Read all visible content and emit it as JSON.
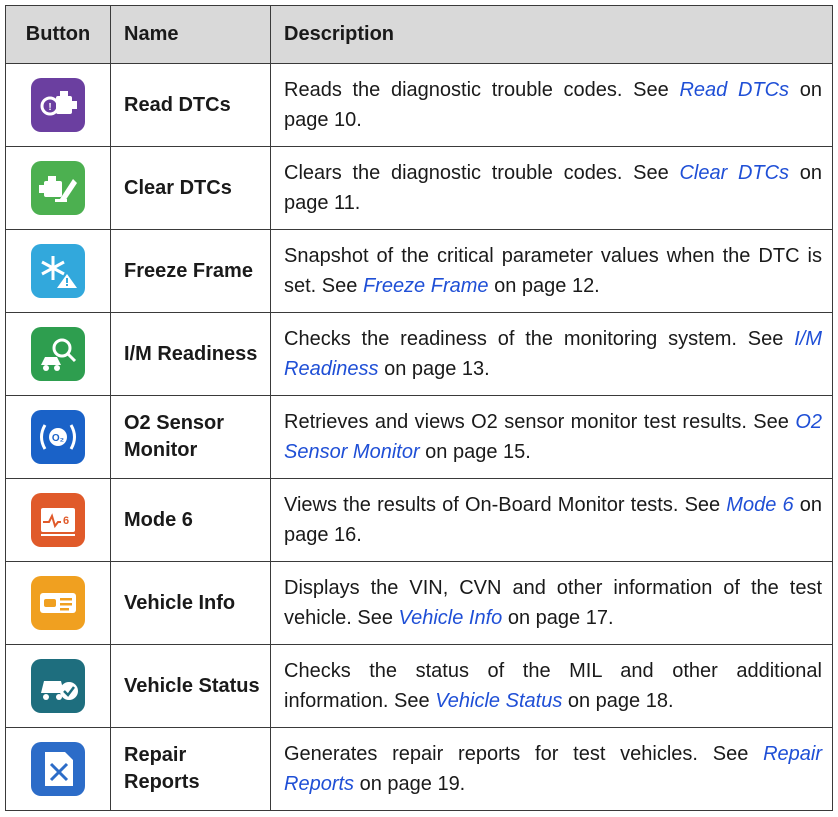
{
  "headers": {
    "button": "Button",
    "name": "Name",
    "description": "Description"
  },
  "rows": [
    {
      "icon": "engine-check-icon",
      "color": "#6b3fa0",
      "name": "Read DTCs",
      "pre": "Reads the diagnostic trouble codes. See ",
      "link": "Read DTCs",
      "post": " on page 10."
    },
    {
      "icon": "engine-clear-icon",
      "color": "#4cb050",
      "name": "Clear DTCs",
      "pre": "Clears the diagnostic trouble codes. See ",
      "link": "Clear DTCs",
      "post": " on page 11."
    },
    {
      "icon": "snowflake-warning-icon",
      "color": "#32a8dc",
      "name": "Freeze Frame",
      "pre": "Snapshot of the critical parameter values when the DTC is set. See ",
      "link": "Freeze Frame",
      "post": " on page 12."
    },
    {
      "icon": "car-inspection-icon",
      "color": "#2e9e4f",
      "name": "I/M Readiness",
      "pre": "Checks the readiness of the monitoring system. See ",
      "link": "I/M Readiness",
      "post": " on page 13."
    },
    {
      "icon": "o2-sensor-icon",
      "color": "#1a62c8",
      "name": "O2 Sensor Monitor",
      "pre": "Retrieves and views O2 sensor monitor test results. See ",
      "link": "O2 Sensor Monitor",
      "post": " on page 15."
    },
    {
      "icon": "waveform-6-icon",
      "color": "#e05a2a",
      "name": "Mode 6",
      "pre": "Views the results of On-Board Monitor tests. See ",
      "link": "Mode 6",
      "post": " on page 16."
    },
    {
      "icon": "vehicle-info-card-icon",
      "color": "#f0a020",
      "name": "Vehicle Info",
      "pre": "Displays the VIN, CVN and other information of the test vehicle. See ",
      "link": "Vehicle Info",
      "post": " on page 17."
    },
    {
      "icon": "vehicle-status-icon",
      "color": "#1e6e7e",
      "name": "Vehicle Status",
      "pre": "Checks the status of the MIL and other additional information. See ",
      "link": "Vehicle Status",
      "post": " on page 18."
    },
    {
      "icon": "repair-report-icon",
      "color": "#2c6cc8",
      "name": "Repair Reports",
      "pre": "Generates repair reports for test vehicles. See ",
      "link": "Repair Reports",
      "post": " on page 19."
    }
  ]
}
